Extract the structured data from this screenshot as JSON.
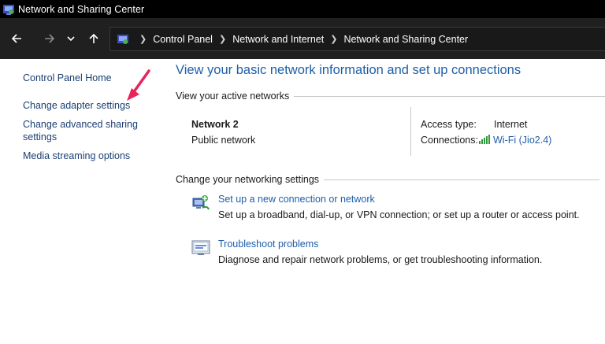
{
  "window": {
    "title": "Network and Sharing Center",
    "icon": "network-center-icon"
  },
  "nav": {
    "back_icon": "back-arrow-icon",
    "forward_icon": "forward-arrow-icon",
    "recent_icon": "chevron-down-icon",
    "up_icon": "up-arrow-icon"
  },
  "breadcrumb": {
    "items": [
      "Control Panel",
      "Network and Internet",
      "Network and Sharing Center"
    ]
  },
  "sidebar": {
    "items": [
      {
        "label": "Control Panel Home"
      },
      {
        "label": "Change adapter settings"
      },
      {
        "label": "Change advanced sharing settings"
      },
      {
        "label": "Media streaming options"
      }
    ]
  },
  "annotation": {
    "color": "#e8245d"
  },
  "main": {
    "title": "View your basic network information and set up connections",
    "active_networks_header": "View your active networks",
    "network": {
      "name": "Network 2",
      "type": "Public network",
      "access_label": "Access type:",
      "access_value": "Internet",
      "connections_label": "Connections:",
      "connections_value": "Wi-Fi (Jio2.4)"
    },
    "settings_header": "Change your networking settings",
    "tasks": [
      {
        "label": "Set up a new connection or network",
        "description": "Set up a broadband, dial-up, or VPN connection; or set up a router or access point.",
        "icon": "new-connection-icon"
      },
      {
        "label": "Troubleshoot problems",
        "description": "Diagnose and repair network problems, or get troubleshooting information.",
        "icon": "troubleshoot-icon"
      }
    ]
  },
  "colors": {
    "link": "#1e5ea8",
    "sidebar_link": "#1b3f73",
    "titlebar": "#000000",
    "navbar": "#202020"
  }
}
